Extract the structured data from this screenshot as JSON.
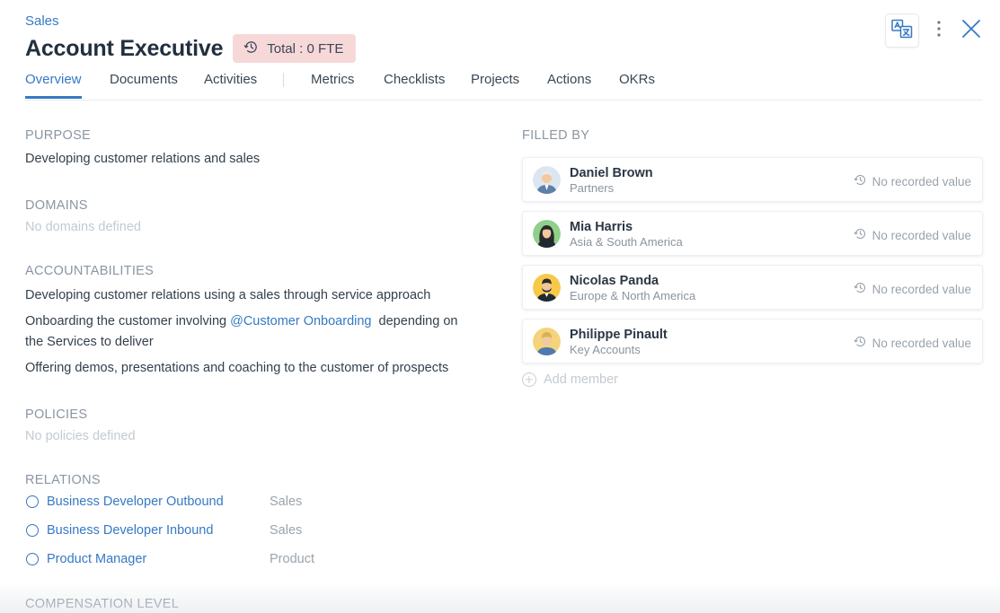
{
  "header": {
    "breadcrumb": "Sales",
    "title": "Account Executive",
    "fte_badge": "Total : 0 FTE"
  },
  "tabs": [
    {
      "label": "Overview",
      "active": true
    },
    {
      "label": "Documents"
    },
    {
      "label": "Activities"
    },
    {
      "label": "Metrics"
    },
    {
      "label": "Checklists"
    },
    {
      "label": "Projects"
    },
    {
      "label": "Actions"
    },
    {
      "label": "OKRs"
    }
  ],
  "purpose": {
    "label": "PURPOSE",
    "text": "Developing customer relations and sales"
  },
  "domains": {
    "label": "DOMAINS",
    "empty": "No domains defined"
  },
  "accountabilities": {
    "label": "ACCOUNTABILITIES",
    "item1": "Developing customer relations using a sales through service approach",
    "item2_before": "Onboarding the customer involving ",
    "item2_link": "@Customer Onboarding",
    "item2_after": "  depending on the Services to deliver",
    "item3": "Offering demos, presentations and coaching to the customer of prospects"
  },
  "policies": {
    "label": "POLICIES",
    "empty": "No policies defined"
  },
  "relations": {
    "label": "RELATIONS",
    "items": [
      {
        "name": "Business Developer Outbound",
        "group": "Sales"
      },
      {
        "name": "Business Developer Inbound",
        "group": "Sales"
      },
      {
        "name": "Product Manager",
        "group": "Product"
      }
    ]
  },
  "compensation": {
    "label": "COMPENSATION LEVEL"
  },
  "filled_by": {
    "label": "FILLED BY",
    "members": [
      {
        "name": "Daniel Brown",
        "team": "Partners",
        "value": "No recorded value"
      },
      {
        "name": "Mia Harris",
        "team": "Asia & South America",
        "value": "No recorded value"
      },
      {
        "name": "Nicolas Panda",
        "team": "Europe & North America",
        "value": "No recorded value"
      },
      {
        "name": "Philippe Pinault",
        "team": "Key Accounts",
        "value": "No recorded value"
      }
    ],
    "add_label": "Add member"
  },
  "colors": {
    "accent": "#3579c4",
    "badge_bg": "#f7d8d9",
    "muted": "#8a96a2"
  },
  "icons": [
    "history-icon",
    "translate-icon",
    "more-vertical-icon",
    "close-icon",
    "plus-circle-icon",
    "avatar-icon"
  ]
}
